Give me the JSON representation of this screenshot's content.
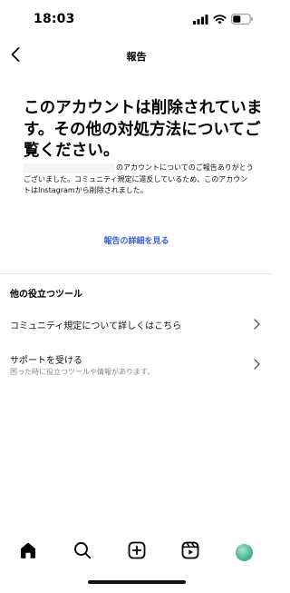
{
  "status_bar": {
    "time": "18:03",
    "icons": [
      "cellular-signal-icon",
      "wifi-icon",
      "battery-icon"
    ]
  },
  "nav": {
    "title": "報告",
    "back_icon": "chevron-left-icon"
  },
  "main": {
    "heading": "このアカウントは削除されています。その他の対処方法についてご覧ください。",
    "report_text": "のアカウントについてのご報告ありがとうございました。コミュニティ規定に違反しているため、このアカウントはInstagramから削除されました。",
    "report_link": "報告の詳細を見る"
  },
  "other_tools": {
    "title": "他の役立つツール",
    "items": [
      {
        "label": "コミュニティ規定について詳しくはこちら",
        "sub": ""
      },
      {
        "label": "サポートを受ける",
        "sub": "困った時に役立つツールや情報があります。"
      }
    ]
  },
  "tab_bar": {
    "items": [
      "home-icon",
      "search-icon",
      "create-icon",
      "reels-icon",
      "profile-avatar"
    ]
  },
  "colors": {
    "link": "#3b5fd6",
    "secondary_text": "#8a8a8a",
    "divider": "#e3e3e3"
  }
}
